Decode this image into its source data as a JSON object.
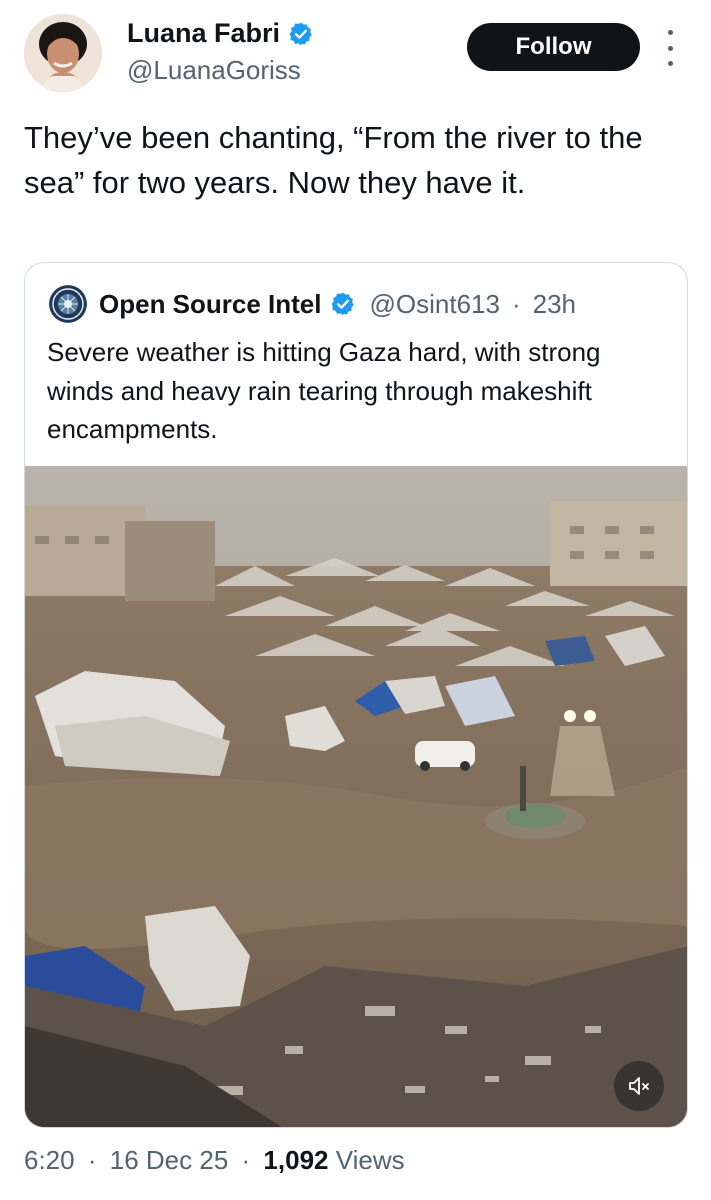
{
  "author": {
    "name": "Luana Fabri",
    "handle": "@LuanaGoriss",
    "verified": true
  },
  "follow_label": "Follow",
  "tweet_text": "They’ve been chanting, “From the river to the sea” for two years. Now they have it.",
  "quoted": {
    "name": "Open Source Intel",
    "handle": "@Osint613",
    "dot": "·",
    "age": "23h",
    "verified": true,
    "text": "Severe weather is hitting Gaza hard, with strong winds and heavy rain tearing through makeshift encampments."
  },
  "media": {
    "type": "video",
    "icon": "mute-icon"
  },
  "meta": {
    "time": "6:20",
    "date": "16 Dec 25",
    "views_count": "1,092",
    "views_label": "Views",
    "sep": "·"
  },
  "colors": {
    "verified_blue": "#1d9bf0",
    "text": "#0f1419",
    "secondary": "#536471",
    "border": "#cfd9de"
  }
}
